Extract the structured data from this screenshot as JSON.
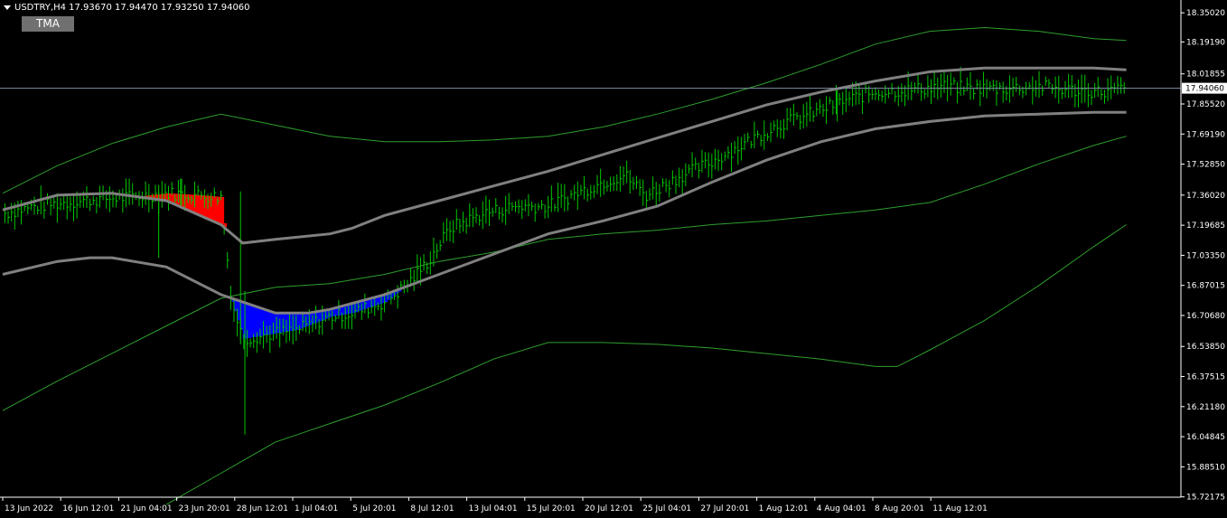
{
  "header": {
    "symbol_line": "USDTRY,H4  17.93670 17.94470 17.93250 17.94060",
    "indicator_button": "TMA"
  },
  "colors": {
    "background": "#000000",
    "axis": "#ffffff",
    "candles": "#00c800",
    "bands": "#2e9e2e",
    "tma": "#808080",
    "fill_up": "#0000ff",
    "fill_down": "#ff0000",
    "price_line": "#7f8fa6"
  },
  "chart_data": {
    "type": "line",
    "symbol": "USDTRY",
    "timeframe": "H4",
    "ohlc_last": {
      "open": 17.9367,
      "high": 17.9447,
      "low": 17.9325,
      "close": 17.9406
    },
    "current_price": 17.9406,
    "current_price_label": "17.94060",
    "ylim": [
      15.72,
      18.4
    ],
    "yticks": [
      "18.35020",
      "18.19190",
      "18.01855",
      "17.85520",
      "17.69190",
      "17.52850",
      "17.36020",
      "17.19685",
      "17.03350",
      "16.87015",
      "16.70680",
      "16.53850",
      "16.37515",
      "16.21180",
      "16.04845",
      "15.88510",
      "15.72175"
    ],
    "xticks": [
      "13 Jun 2022",
      "16 Jun 12:01",
      "21 Jun 04:01",
      "23 Jun 20:01",
      "28 Jun 12:01",
      "1 Jul 04:01",
      "5 Jul 20:01",
      "8 Jul 12:01",
      "13 Jul 04:01",
      "15 Jul 20:01",
      "20 Jul 12:01",
      "25 Jul 04:01",
      "27 Jul 20:01",
      "1 Aug 12:01",
      "4 Aug 04:01",
      "8 Aug 20:01",
      "11 Aug 12:01"
    ],
    "series": [
      {
        "role": "tma_upper",
        "x": [
          0,
          5,
          10,
          15,
          20,
          22,
          25,
          30,
          32,
          35,
          40,
          45,
          50,
          55,
          60,
          65,
          70,
          75,
          80,
          85,
          90,
          95,
          100,
          103
        ],
        "values": [
          17.28,
          17.36,
          17.37,
          17.33,
          17.2,
          17.1,
          17.12,
          17.15,
          17.18,
          17.25,
          17.33,
          17.41,
          17.49,
          17.58,
          17.67,
          17.76,
          17.85,
          17.92,
          17.98,
          18.03,
          18.05,
          18.05,
          18.05,
          18.04
        ]
      },
      {
        "role": "tma_lower",
        "x": [
          0,
          5,
          8,
          10,
          15,
          20,
          25,
          28,
          30,
          35,
          40,
          45,
          50,
          55,
          60,
          65,
          70,
          75,
          80,
          85,
          90,
          95,
          100,
          103
        ],
        "values": [
          16.93,
          17.0,
          17.02,
          17.02,
          16.97,
          16.82,
          16.72,
          16.72,
          16.74,
          16.82,
          16.93,
          17.04,
          17.15,
          17.22,
          17.3,
          17.43,
          17.55,
          17.65,
          17.72,
          17.76,
          17.79,
          17.8,
          17.81,
          17.81
        ]
      },
      {
        "role": "outer_band_upper",
        "x": [
          0,
          5,
          10,
          15,
          20,
          25,
          30,
          35,
          40,
          45,
          50,
          55,
          60,
          65,
          70,
          75,
          80,
          85,
          90,
          95,
          100,
          103
        ],
        "values": [
          17.37,
          17.52,
          17.64,
          17.73,
          17.8,
          17.74,
          17.68,
          17.65,
          17.65,
          17.66,
          17.68,
          17.73,
          17.8,
          17.88,
          17.97,
          18.07,
          18.18,
          18.25,
          18.27,
          18.25,
          18.21,
          18.2
        ]
      },
      {
        "role": "outer_band_lower",
        "x": [
          0,
          5,
          10,
          15,
          20,
          25,
          30,
          35,
          40,
          45,
          50,
          55,
          60,
          65,
          70,
          75,
          80,
          85,
          90,
          95,
          100,
          103
        ],
        "values": [
          16.19,
          16.35,
          16.5,
          16.65,
          16.8,
          16.86,
          16.88,
          16.93,
          17.0,
          17.05,
          17.12,
          17.15,
          17.17,
          17.2,
          17.22,
          17.25,
          17.28,
          17.32,
          17.42,
          17.53,
          17.63,
          17.68
        ]
      },
      {
        "role": "inner_band",
        "x": [
          15,
          20,
          25,
          28,
          30,
          35,
          40,
          45,
          50,
          52,
          55,
          60,
          65,
          70,
          75,
          80,
          82,
          85,
          90,
          95,
          100,
          103
        ],
        "values": [
          15.68,
          15.85,
          16.02,
          16.08,
          16.12,
          16.22,
          16.34,
          16.47,
          16.56,
          16.56,
          16.56,
          16.55,
          16.53,
          16.5,
          16.47,
          16.43,
          16.43,
          16.52,
          16.68,
          16.87,
          17.08,
          17.2
        ]
      },
      {
        "role": "price",
        "x": [
          0,
          3,
          6,
          9,
          12,
          15,
          18,
          20,
          21,
          22,
          24,
          27,
          30,
          32,
          35,
          37,
          39,
          41,
          44,
          47,
          50,
          53,
          55,
          57,
          59,
          62,
          65,
          68,
          71,
          74,
          77,
          80,
          83,
          86,
          89,
          92,
          95,
          98,
          101,
          103
        ],
        "values": [
          17.26,
          17.3,
          17.32,
          17.34,
          17.35,
          17.37,
          17.36,
          17.35,
          16.78,
          16.58,
          16.6,
          16.63,
          16.7,
          16.72,
          16.78,
          16.87,
          17.0,
          17.18,
          17.26,
          17.3,
          17.3,
          17.38,
          17.43,
          17.47,
          17.36,
          17.46,
          17.54,
          17.64,
          17.74,
          17.8,
          17.87,
          17.92,
          17.93,
          17.95,
          17.94,
          17.94,
          17.95,
          17.93,
          17.92,
          17.94
        ]
      }
    ]
  }
}
